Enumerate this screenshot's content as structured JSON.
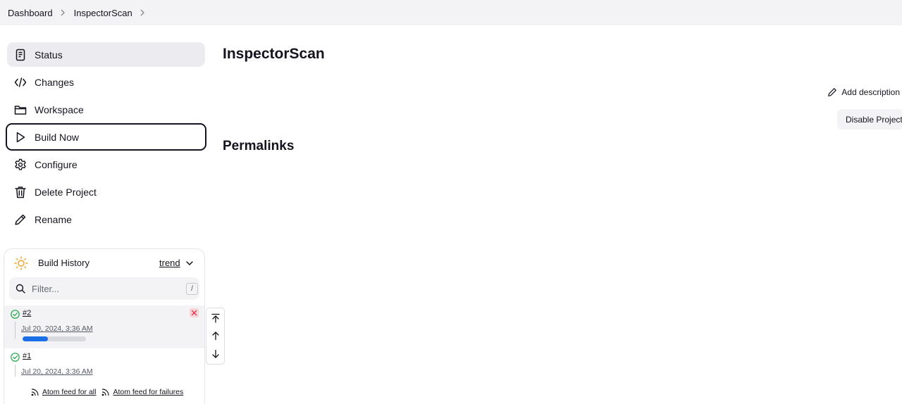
{
  "breadcrumb": {
    "items": [
      {
        "label": "Dashboard"
      },
      {
        "label": "InspectorScan"
      }
    ]
  },
  "sidebar": {
    "items": [
      {
        "label": "Status",
        "icon": "document-icon"
      },
      {
        "label": "Changes",
        "icon": "code-icon"
      },
      {
        "label": "Workspace",
        "icon": "folder-icon"
      },
      {
        "label": "Build Now",
        "icon": "play-icon"
      },
      {
        "label": "Configure",
        "icon": "gear-icon"
      },
      {
        "label": "Delete Project",
        "icon": "trash-icon"
      },
      {
        "label": "Rename",
        "icon": "pencil-icon"
      }
    ]
  },
  "main": {
    "title": "InspectorScan",
    "add_description": "Add description",
    "disable_project": "Disable Project",
    "permalinks_title": "Permalinks"
  },
  "build_history": {
    "title": "Build History",
    "trend_label": "trend",
    "filter_placeholder": "Filter...",
    "filter_shortcut": "/",
    "runs": [
      {
        "number": "#2",
        "date": "Jul 20, 2024, 3:36 AM",
        "status": "success",
        "progress": 0.4,
        "in_progress": true
      },
      {
        "number": "#1",
        "date": "Jul 20, 2024, 3:36 AM",
        "status": "success",
        "in_progress": false
      }
    ],
    "feeds": {
      "all": "Atom feed for all",
      "failures": "Atom feed for failures"
    }
  },
  "colors": {
    "accent": "#1a6fe6",
    "success": "#1ea446",
    "danger": "#e6304a",
    "panel_bg": "#f3f3f5"
  }
}
